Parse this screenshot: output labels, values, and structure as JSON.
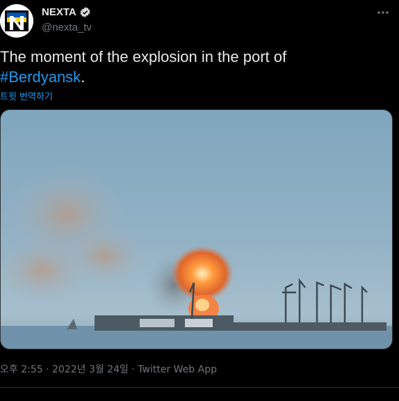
{
  "author": {
    "display_name": "NEXTA",
    "handle": "@nexta_tv",
    "verified": true,
    "avatar_colors": {
      "bg": "#ffffff",
      "flag_top": "#0057b8",
      "flag_bottom": "#ffd700",
      "letter": "#000000"
    }
  },
  "tweet": {
    "text_prefix": "The moment of the explosion in the port of",
    "hashtag": "#Berdyansk",
    "text_suffix": ".",
    "translate_label": "트윗 번역하기"
  },
  "media": {
    "kind": "photo",
    "description_icon": "image-icon"
  },
  "meta": {
    "time": "오후 2:55",
    "date": "2022년 3월 24일",
    "separator": "·",
    "source": "Twitter Web App"
  },
  "colors": {
    "background": "#000000",
    "text": "#e7e9ea",
    "secondary": "#71767b",
    "accent": "#1d9bf0",
    "border": "#2f3336"
  }
}
